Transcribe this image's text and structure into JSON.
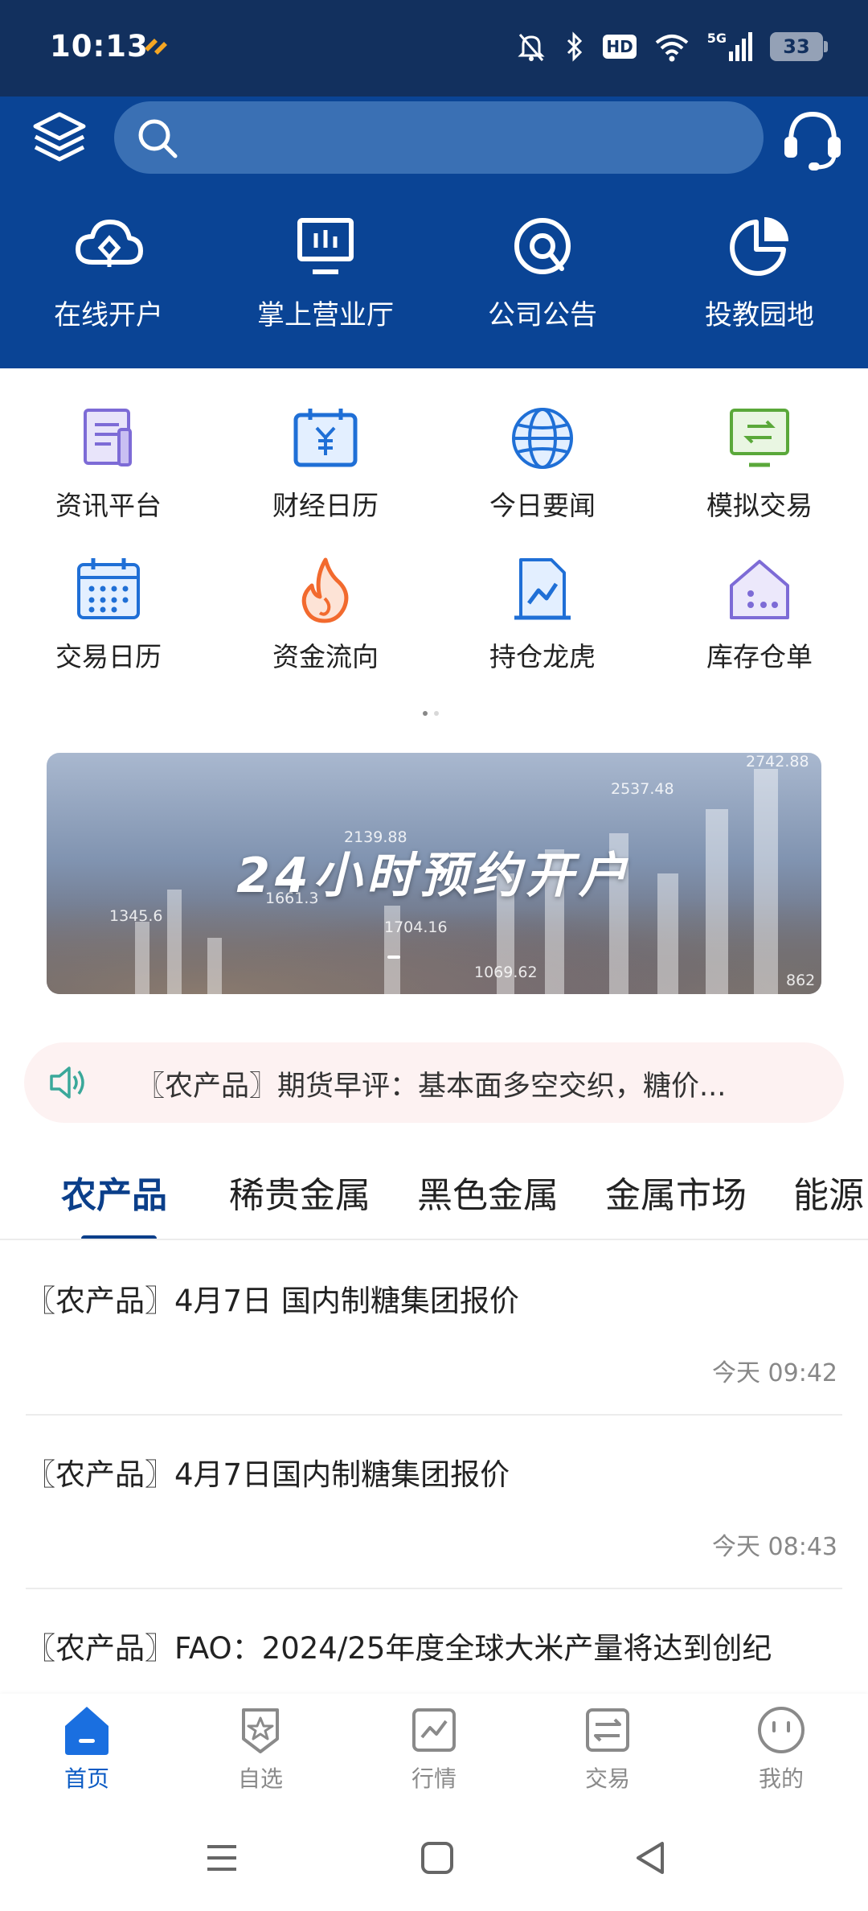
{
  "status_bar": {
    "time": "10:13",
    "network_type": "5G",
    "hd_label": "HD",
    "battery": "33"
  },
  "header": {
    "search_placeholder": "",
    "quick_actions": [
      {
        "label": "在线开户",
        "icon": "cloud-plus-icon"
      },
      {
        "label": "掌上营业厅",
        "icon": "monitor-icon"
      },
      {
        "label": "公司公告",
        "icon": "at-sign-icon"
      },
      {
        "label": "投教园地",
        "icon": "pie-chart-icon"
      }
    ]
  },
  "features": [
    {
      "label": "资讯平台",
      "icon": "document-icon"
    },
    {
      "label": "财经日历",
      "icon": "yen-calendar-icon"
    },
    {
      "label": "今日要闻",
      "icon": "globe-icon"
    },
    {
      "label": "模拟交易",
      "icon": "exchange-monitor-icon"
    },
    {
      "label": "交易日历",
      "icon": "calendar-icon"
    },
    {
      "label": "资金流向",
      "icon": "flame-icon"
    },
    {
      "label": "持仓龙虎",
      "icon": "chart-document-icon"
    },
    {
      "label": "库存仓单",
      "icon": "warehouse-icon"
    }
  ],
  "banner": {
    "title": "24小时预约开户",
    "numbers": [
      "2742.88",
      "2537.48",
      "2139.88",
      "1345.6",
      "1661.3",
      "1704.16",
      "1069.62",
      "862"
    ]
  },
  "ticker": {
    "text": "〖农产品〗期货早评：基本面多空交织，糖价..."
  },
  "tabs": [
    {
      "label": "农产品",
      "active": true
    },
    {
      "label": "稀贵金属",
      "active": false
    },
    {
      "label": "黑色金属",
      "active": false
    },
    {
      "label": "金属市场",
      "active": false
    },
    {
      "label": "能源",
      "active": false
    }
  ],
  "news": [
    {
      "title": "〖农产品〗4月7日 国内制糖集团报价",
      "time": "今天 09:42"
    },
    {
      "title": "〖农产品〗4月7日国内制糖集团报价",
      "time": "今天 08:43"
    },
    {
      "title": "〖农产品〗FAO：2024/25年度全球大米产量将达到创纪",
      "time": ""
    }
  ],
  "bottom_nav": [
    {
      "label": "首页",
      "icon": "home-icon",
      "active": true
    },
    {
      "label": "自选",
      "icon": "star-badge-icon",
      "active": false
    },
    {
      "label": "行情",
      "icon": "market-chart-icon",
      "active": false
    },
    {
      "label": "交易",
      "icon": "trade-exchange-icon",
      "active": false
    },
    {
      "label": "我的",
      "icon": "smiley-profile-icon",
      "active": false
    }
  ],
  "colors": {
    "header_blue": "#0a4495",
    "status_bar": "#12305e",
    "active_tab": "#0b3f8a",
    "active_nav": "#0b5bc4"
  }
}
